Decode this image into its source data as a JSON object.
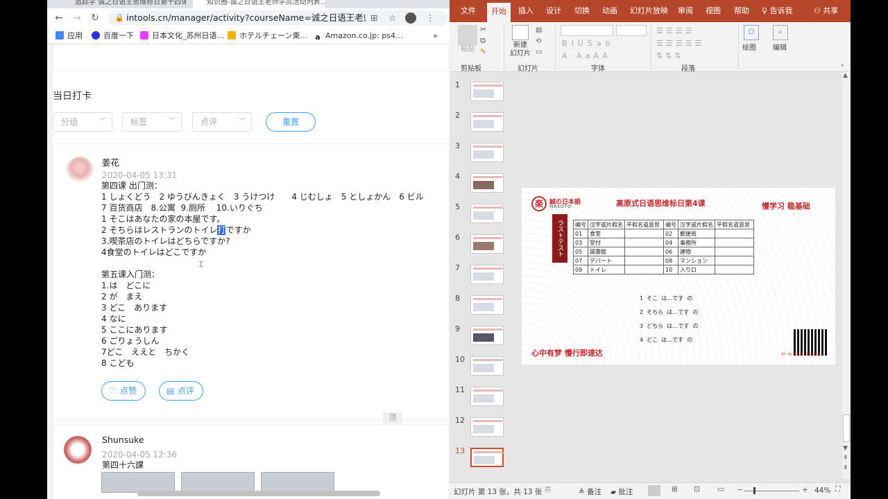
{
  "browser": {
    "tabs": [
      {
        "label": "追踪学 诚之日语王思维标日第十四课..."
      },
      {
        "label": "知识圈-诚之日语王老师学员活动列表..."
      }
    ],
    "url": "intools.cn/manager/activity?courseName=诚之日语王老师学员...",
    "bookmarks": [
      {
        "label": "应用",
        "color": "#4285f4"
      },
      {
        "label": "百度一下",
        "color": "#2932e1"
      },
      {
        "label": "日本文化_苏州日语...",
        "color": "#e040fb"
      },
      {
        "label": "ホテルチェーン東...",
        "color": "#f4b400"
      },
      {
        "label": "Amazon.co.jp: ps4...",
        "color": "#222222"
      }
    ],
    "more": "»"
  },
  "page": {
    "section_title": "当日打卡",
    "filters": {
      "group": "分组",
      "tag": "标签",
      "review": "点评",
      "reset": "重置"
    },
    "posts": [
      {
        "user": "姜花",
        "time": "2020-04-05 13:31",
        "lines": [
          "第四课 出门测：",
          "1 しょくどう　2 ゆうびんきょく　3 うけつけ　　4 じむしょ　5 としょかん　6 ビル",
          "7 百货商店　8.公寓  9.厕所　 10.いりぐち",
          "1 そこはあなたの家の本屋です。",
          "2 そちらはレストランのトイレ",
          "3.喫茶店のトイレはどちらですか?",
          "4食堂のトイレはどこですか",
          "",
          "第五课入门测：",
          "1.は　どこに",
          "2 が　まえ",
          "3 どこ　あります",
          "4 なに",
          "5 ここにあります",
          "6 ごりょうしん",
          "7どこ　ええと　ちかく",
          "8 こども"
        ],
        "highlight": "打",
        "line2_tail": "ですか",
        "like": "点赞",
        "comment": "点评"
      },
      {
        "user": "Shunsuke",
        "time": "2020-04-05 12:36",
        "lines": [
          "第四十六課"
        ]
      }
    ],
    "float_label": "顶"
  },
  "ppt": {
    "tabs": [
      "文件",
      "开始",
      "插入",
      "设计",
      "切换",
      "动画",
      "幻灯片放映",
      "审阅",
      "视图",
      "帮助",
      "告诉我",
      "共享"
    ],
    "active_tab": "开始",
    "groups": {
      "clipboard": "剪贴板",
      "slides": "幻灯片",
      "font": "字体",
      "paragraph": "段落",
      "paste": "粘贴",
      "new_slide": "新建\n幻灯片",
      "drawing": "绘图",
      "editing": "编辑"
    },
    "slide_numbers": [
      "1",
      "2",
      "3",
      "4",
      "5",
      "6",
      "7",
      "8",
      "9",
      "10",
      "11",
      "12",
      "13"
    ],
    "selected_slide": "13",
    "status": {
      "slide_info": "幻灯片 第 13 张，共 13 张",
      "notes": "备注",
      "comments": "批注",
      "zoom": "44%"
    },
    "slide": {
      "logo_char": "楽",
      "logo_text": "誠の日本語",
      "logo_sub": "MAKOTO",
      "title": "高原式日语思维标日第4课",
      "subtitle": "慢学习  稳基础",
      "side_label": "ラストテスト",
      "table_header": [
        "编号",
        "汉字或片假名",
        "平假名或意思",
        "编号",
        "汉字或片假名",
        "平假名或意思"
      ],
      "table_rows": [
        [
          "01",
          "食堂",
          "",
          "02",
          "郵便局",
          ""
        ],
        [
          "03",
          "受付",
          "",
          "04",
          "事務所",
          ""
        ],
        [
          "05",
          "図書館",
          "",
          "06",
          "建物",
          ""
        ],
        [
          "07",
          "デパート",
          "",
          "08",
          "マンション",
          ""
        ],
        [
          "09",
          "トイレ",
          "",
          "10",
          "入り口",
          ""
        ]
      ],
      "questions": [
        "1  そこ  は…です  の",
        "2  そちら  は…です  の",
        "3  どちら  は…です  の",
        "4  どこ  は…です  の"
      ],
      "footer": "心中有梦  慢行即速达",
      "qr_caption": "扫一扫\n与高原一起学日语"
    }
  }
}
